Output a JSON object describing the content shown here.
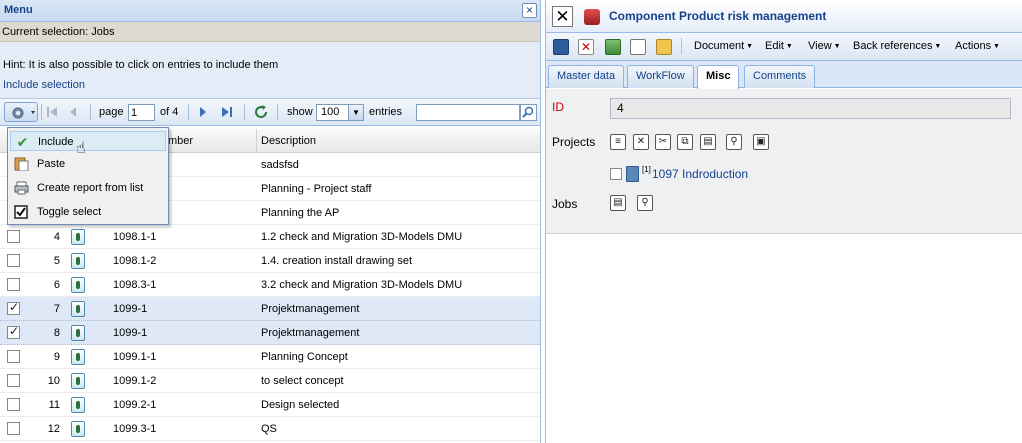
{
  "left": {
    "menu_title": "Menu",
    "current_selection": "Current selection: Jobs",
    "hint": "Hint: It is also possible to click on entries to include them",
    "include_selection": "Include selection",
    "toolbar": {
      "page_label": "page",
      "page_value": "1",
      "of_label": "of 4",
      "show_label": "show",
      "page_size": "100",
      "entries_label": "entries"
    },
    "columns": {
      "number": "mber",
      "description": "Description"
    },
    "rows": [
      {
        "num": "",
        "job": "",
        "desc": "sadsfsd",
        "checked": false
      },
      {
        "num": "",
        "job": "",
        "desc": "Planning - Project staff",
        "checked": false
      },
      {
        "num": "",
        "job": "",
        "desc": "Planning the AP",
        "checked": false
      },
      {
        "num": "4",
        "job": "1098.1-1",
        "desc": "1.2 check and Migration 3D-Models DMU",
        "checked": false
      },
      {
        "num": "5",
        "job": "1098.1-2",
        "desc": "1.4. creation install drawing set",
        "checked": false
      },
      {
        "num": "6",
        "job": "1098.3-1",
        "desc": "3.2 check and Migration 3D-Models DMU",
        "checked": false
      },
      {
        "num": "7",
        "job": "1099-1",
        "desc": "Projektmanagement",
        "checked": true
      },
      {
        "num": "8",
        "job": "1099-1",
        "desc": "Projektmanagement",
        "checked": true
      },
      {
        "num": "9",
        "job": "1099.1-1",
        "desc": "Planning Concept",
        "checked": false
      },
      {
        "num": "10",
        "job": "1099.1-2",
        "desc": "to select concept",
        "checked": false
      },
      {
        "num": "11",
        "job": "1099.2-1",
        "desc": "Design selected",
        "checked": false
      },
      {
        "num": "12",
        "job": "1099.3-1",
        "desc": "QS",
        "checked": false
      }
    ],
    "context_menu": [
      {
        "label": "Include",
        "icon": "checkmark-icon"
      },
      {
        "label": "Paste",
        "icon": "paste-icon"
      },
      {
        "label": "Create report from list",
        "icon": "printer-icon"
      },
      {
        "label": "Toggle select",
        "icon": "toggle-checkbox-icon"
      }
    ]
  },
  "right": {
    "title": "Component Product risk management",
    "menus": [
      "Document",
      "Edit",
      "View",
      "Back references",
      "Actions"
    ],
    "tabs": [
      "Master data",
      "WorkFlow",
      "Misc",
      "Comments"
    ],
    "active_tab": "Misc",
    "form": {
      "id_label": "ID",
      "id_value": "4",
      "projects_label": "Projects",
      "project_sup": "[1]",
      "project_link": "1097 Indroduction",
      "jobs_label": "Jobs"
    }
  },
  "colors": {
    "accent": "#15428b",
    "border": "#99bbe8",
    "selected_row": "#dfe8f6",
    "id_label": "#cc0000"
  }
}
